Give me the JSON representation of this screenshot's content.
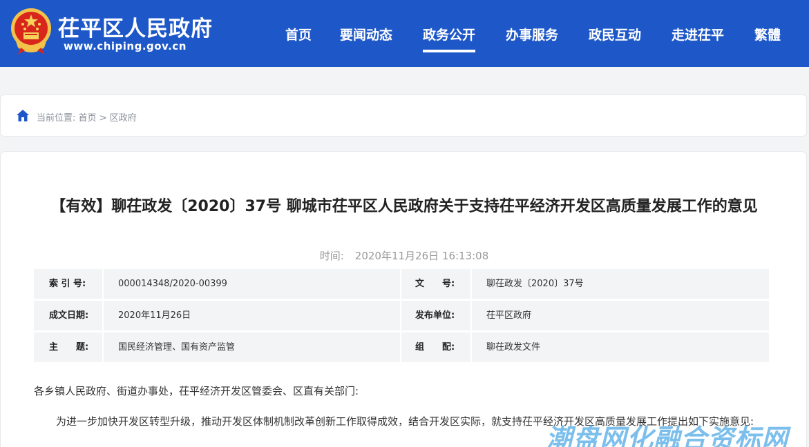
{
  "header": {
    "site_name": "茌平区人民政府",
    "site_url": "www.chiping.gov.cn",
    "brand_color": "#1e58c8",
    "nav": [
      {
        "label": "首页",
        "active": false
      },
      {
        "label": "要闻动态",
        "active": false
      },
      {
        "label": "政务公开",
        "active": true
      },
      {
        "label": "办事服务",
        "active": false
      },
      {
        "label": "政民互动",
        "active": false
      },
      {
        "label": "走进茌平",
        "active": false
      },
      {
        "label": "繁體",
        "active": false
      }
    ]
  },
  "breadcrumb": {
    "prefix": "当前位置:",
    "items": [
      "首页",
      "区政府"
    ],
    "separator": ">"
  },
  "article": {
    "title": "【有效】聊茌政发〔2020〕37号 聊城市茌平区人民政府关于支持茌平经济开发区高质量发展工作的意见",
    "time_label": "时间:",
    "time_value": "2020年11月26日 16:13:08",
    "meta": [
      {
        "k1": "索 引 号:",
        "v1": "000014348/2020-00399",
        "k2": "文　　号:",
        "v2": "聊茌政发〔2020〕37号"
      },
      {
        "k1": "成文日期:",
        "v1": "2020年11月26日",
        "k2": "发布单位:",
        "v2": "茌平区政府"
      },
      {
        "k1": "主　　题:",
        "v1": "国民经济管理、国有资产监管",
        "k2": "组　　配:",
        "v2": "聊茌政发文件"
      }
    ],
    "salutation": "各乡镇人民政府、街道办事处，茌平经济开发区管委会、区直有关部门:",
    "body": "为进一步加快开发区转型升级，推动开发区体制机制改革创新工作取得成效，结合开发区实际，就支持茌平经济开发区高质量发展工作提出如下实施意见:"
  },
  "watermark": "潮盘网化融合资标网"
}
